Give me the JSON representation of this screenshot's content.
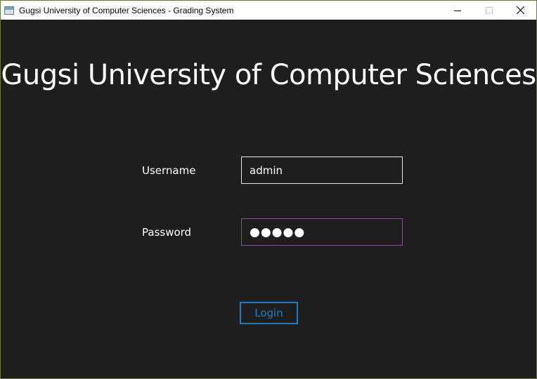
{
  "window": {
    "title": "Gugsi University of Computer Sciences - Grading System",
    "icon": "app-window-icon",
    "controls": [
      "minimize-icon",
      "maximize-icon",
      "close-icon"
    ]
  },
  "main": {
    "heading": "Gugsi University of Computer Sciences",
    "username": {
      "label": "Username",
      "value": "admin"
    },
    "password": {
      "label": "Password",
      "masked_value": "●●●●●"
    },
    "login_label": "Login"
  },
  "colors": {
    "background": "#1e1e1e",
    "accent": "#1e7cc4",
    "focus_border": "#8d4b9c",
    "text": "#ffffff"
  }
}
